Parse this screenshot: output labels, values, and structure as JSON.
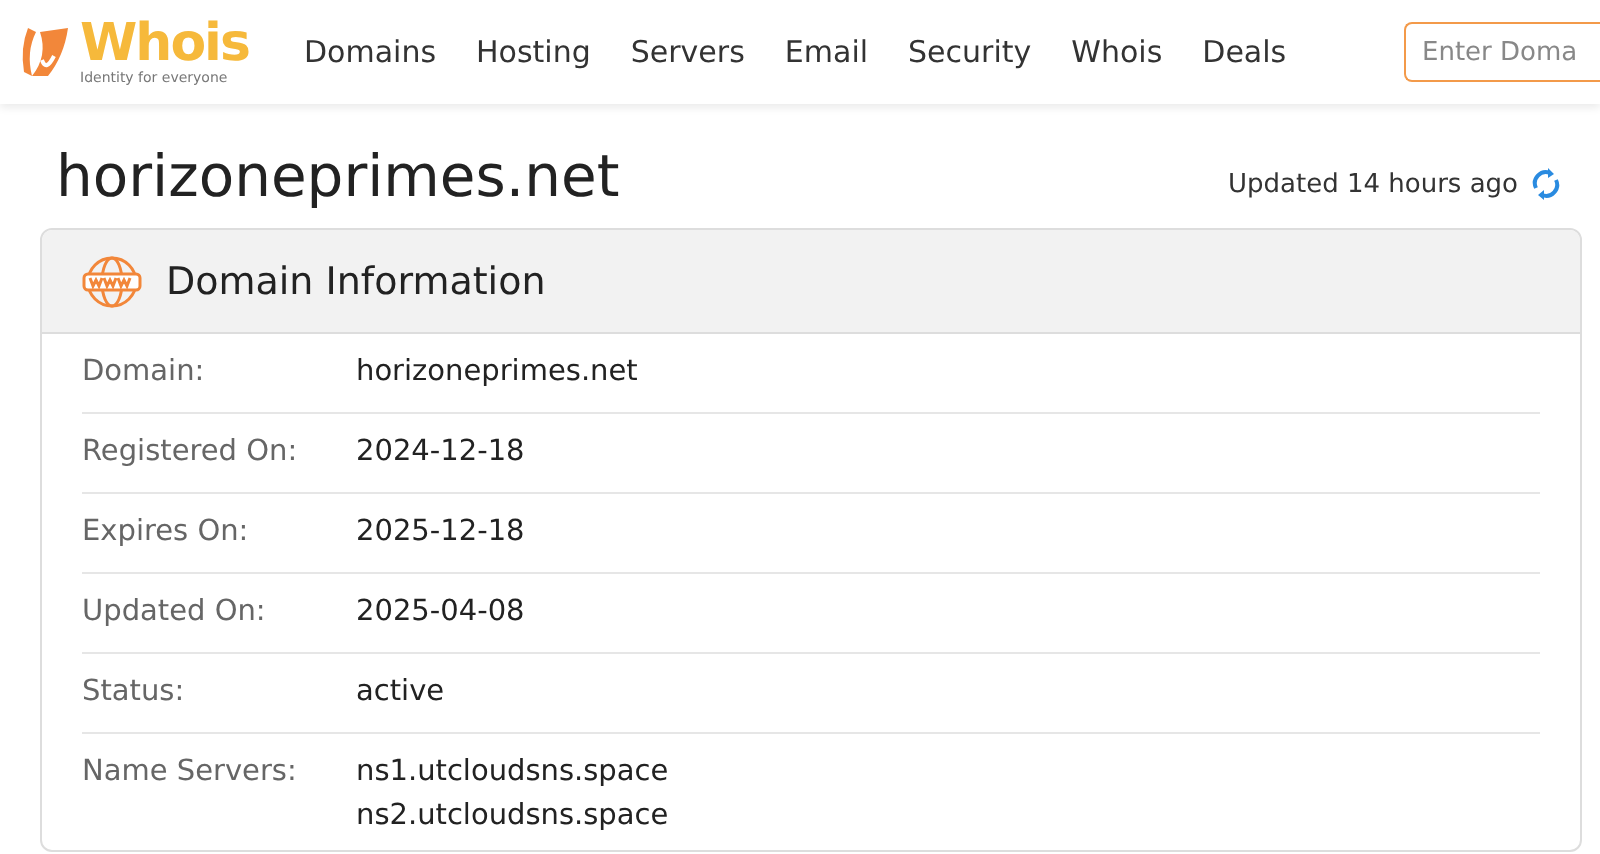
{
  "header": {
    "logo": {
      "name": "Whois",
      "tagline": "Identity for everyone"
    },
    "nav": [
      "Domains",
      "Hosting",
      "Servers",
      "Email",
      "Security",
      "Whois",
      "Deals"
    ],
    "search": {
      "placeholder": "Enter Doma"
    }
  },
  "page": {
    "title": "horizoneprimes.net",
    "updated": "Updated 14 hours ago"
  },
  "card": {
    "title": "Domain Information",
    "rows": [
      {
        "label": "Domain:",
        "values": [
          "horizoneprimes.net"
        ]
      },
      {
        "label": "Registered On:",
        "values": [
          "2024-12-18"
        ]
      },
      {
        "label": "Expires On:",
        "values": [
          "2025-12-18"
        ]
      },
      {
        "label": "Updated On:",
        "values": [
          "2025-04-08"
        ]
      },
      {
        "label": "Status:",
        "values": [
          "active"
        ]
      },
      {
        "label": "Name Servers:",
        "values": [
          "ns1.utcloudsns.space",
          "ns2.utcloudsns.space"
        ]
      }
    ]
  }
}
